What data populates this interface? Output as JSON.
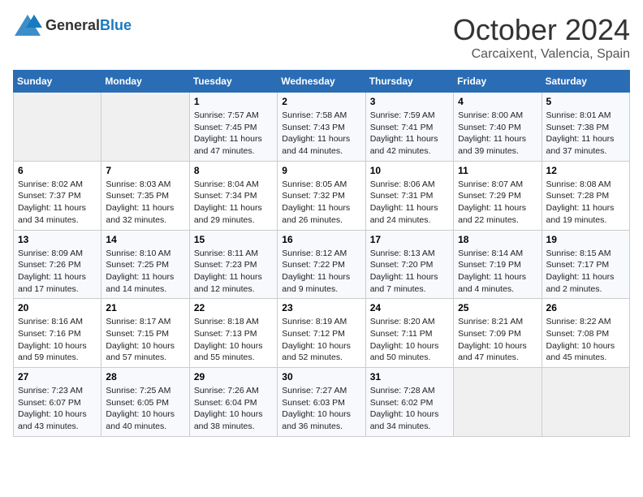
{
  "header": {
    "logo": {
      "text1": "General",
      "text2": "Blue"
    },
    "month": "October 2024",
    "location": "Carcaixent, Valencia, Spain"
  },
  "weekdays": [
    "Sunday",
    "Monday",
    "Tuesday",
    "Wednesday",
    "Thursday",
    "Friday",
    "Saturday"
  ],
  "weeks": [
    [
      {
        "day": "",
        "sunrise": "",
        "sunset": "",
        "daylight": ""
      },
      {
        "day": "",
        "sunrise": "",
        "sunset": "",
        "daylight": ""
      },
      {
        "day": "1",
        "sunrise": "Sunrise: 7:57 AM",
        "sunset": "Sunset: 7:45 PM",
        "daylight": "Daylight: 11 hours and 47 minutes."
      },
      {
        "day": "2",
        "sunrise": "Sunrise: 7:58 AM",
        "sunset": "Sunset: 7:43 PM",
        "daylight": "Daylight: 11 hours and 44 minutes."
      },
      {
        "day": "3",
        "sunrise": "Sunrise: 7:59 AM",
        "sunset": "Sunset: 7:41 PM",
        "daylight": "Daylight: 11 hours and 42 minutes."
      },
      {
        "day": "4",
        "sunrise": "Sunrise: 8:00 AM",
        "sunset": "Sunset: 7:40 PM",
        "daylight": "Daylight: 11 hours and 39 minutes."
      },
      {
        "day": "5",
        "sunrise": "Sunrise: 8:01 AM",
        "sunset": "Sunset: 7:38 PM",
        "daylight": "Daylight: 11 hours and 37 minutes."
      }
    ],
    [
      {
        "day": "6",
        "sunrise": "Sunrise: 8:02 AM",
        "sunset": "Sunset: 7:37 PM",
        "daylight": "Daylight: 11 hours and 34 minutes."
      },
      {
        "day": "7",
        "sunrise": "Sunrise: 8:03 AM",
        "sunset": "Sunset: 7:35 PM",
        "daylight": "Daylight: 11 hours and 32 minutes."
      },
      {
        "day": "8",
        "sunrise": "Sunrise: 8:04 AM",
        "sunset": "Sunset: 7:34 PM",
        "daylight": "Daylight: 11 hours and 29 minutes."
      },
      {
        "day": "9",
        "sunrise": "Sunrise: 8:05 AM",
        "sunset": "Sunset: 7:32 PM",
        "daylight": "Daylight: 11 hours and 26 minutes."
      },
      {
        "day": "10",
        "sunrise": "Sunrise: 8:06 AM",
        "sunset": "Sunset: 7:31 PM",
        "daylight": "Daylight: 11 hours and 24 minutes."
      },
      {
        "day": "11",
        "sunrise": "Sunrise: 8:07 AM",
        "sunset": "Sunset: 7:29 PM",
        "daylight": "Daylight: 11 hours and 22 minutes."
      },
      {
        "day": "12",
        "sunrise": "Sunrise: 8:08 AM",
        "sunset": "Sunset: 7:28 PM",
        "daylight": "Daylight: 11 hours and 19 minutes."
      }
    ],
    [
      {
        "day": "13",
        "sunrise": "Sunrise: 8:09 AM",
        "sunset": "Sunset: 7:26 PM",
        "daylight": "Daylight: 11 hours and 17 minutes."
      },
      {
        "day": "14",
        "sunrise": "Sunrise: 8:10 AM",
        "sunset": "Sunset: 7:25 PM",
        "daylight": "Daylight: 11 hours and 14 minutes."
      },
      {
        "day": "15",
        "sunrise": "Sunrise: 8:11 AM",
        "sunset": "Sunset: 7:23 PM",
        "daylight": "Daylight: 11 hours and 12 minutes."
      },
      {
        "day": "16",
        "sunrise": "Sunrise: 8:12 AM",
        "sunset": "Sunset: 7:22 PM",
        "daylight": "Daylight: 11 hours and 9 minutes."
      },
      {
        "day": "17",
        "sunrise": "Sunrise: 8:13 AM",
        "sunset": "Sunset: 7:20 PM",
        "daylight": "Daylight: 11 hours and 7 minutes."
      },
      {
        "day": "18",
        "sunrise": "Sunrise: 8:14 AM",
        "sunset": "Sunset: 7:19 PM",
        "daylight": "Daylight: 11 hours and 4 minutes."
      },
      {
        "day": "19",
        "sunrise": "Sunrise: 8:15 AM",
        "sunset": "Sunset: 7:17 PM",
        "daylight": "Daylight: 11 hours and 2 minutes."
      }
    ],
    [
      {
        "day": "20",
        "sunrise": "Sunrise: 8:16 AM",
        "sunset": "Sunset: 7:16 PM",
        "daylight": "Daylight: 10 hours and 59 minutes."
      },
      {
        "day": "21",
        "sunrise": "Sunrise: 8:17 AM",
        "sunset": "Sunset: 7:15 PM",
        "daylight": "Daylight: 10 hours and 57 minutes."
      },
      {
        "day": "22",
        "sunrise": "Sunrise: 8:18 AM",
        "sunset": "Sunset: 7:13 PM",
        "daylight": "Daylight: 10 hours and 55 minutes."
      },
      {
        "day": "23",
        "sunrise": "Sunrise: 8:19 AM",
        "sunset": "Sunset: 7:12 PM",
        "daylight": "Daylight: 10 hours and 52 minutes."
      },
      {
        "day": "24",
        "sunrise": "Sunrise: 8:20 AM",
        "sunset": "Sunset: 7:11 PM",
        "daylight": "Daylight: 10 hours and 50 minutes."
      },
      {
        "day": "25",
        "sunrise": "Sunrise: 8:21 AM",
        "sunset": "Sunset: 7:09 PM",
        "daylight": "Daylight: 10 hours and 47 minutes."
      },
      {
        "day": "26",
        "sunrise": "Sunrise: 8:22 AM",
        "sunset": "Sunset: 7:08 PM",
        "daylight": "Daylight: 10 hours and 45 minutes."
      }
    ],
    [
      {
        "day": "27",
        "sunrise": "Sunrise: 7:23 AM",
        "sunset": "Sunset: 6:07 PM",
        "daylight": "Daylight: 10 hours and 43 minutes."
      },
      {
        "day": "28",
        "sunrise": "Sunrise: 7:25 AM",
        "sunset": "Sunset: 6:05 PM",
        "daylight": "Daylight: 10 hours and 40 minutes."
      },
      {
        "day": "29",
        "sunrise": "Sunrise: 7:26 AM",
        "sunset": "Sunset: 6:04 PM",
        "daylight": "Daylight: 10 hours and 38 minutes."
      },
      {
        "day": "30",
        "sunrise": "Sunrise: 7:27 AM",
        "sunset": "Sunset: 6:03 PM",
        "daylight": "Daylight: 10 hours and 36 minutes."
      },
      {
        "day": "31",
        "sunrise": "Sunrise: 7:28 AM",
        "sunset": "Sunset: 6:02 PM",
        "daylight": "Daylight: 10 hours and 34 minutes."
      },
      {
        "day": "",
        "sunrise": "",
        "sunset": "",
        "daylight": ""
      },
      {
        "day": "",
        "sunrise": "",
        "sunset": "",
        "daylight": ""
      }
    ]
  ]
}
